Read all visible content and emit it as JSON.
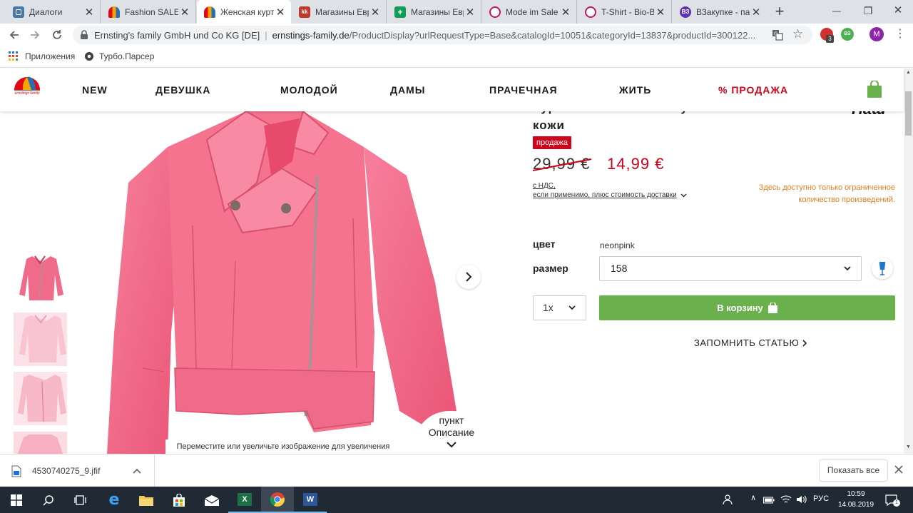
{
  "browser": {
    "tabs": [
      {
        "title": "Диалоги",
        "fav_color": "#4a76a8",
        "fav_text": "",
        "active": false
      },
      {
        "title": "Fashion SALE | Ernsting",
        "fav_color": "#e30613",
        "fav_text": "",
        "active": false
      },
      {
        "title": "Женская куртка",
        "fav_color": "#e30613",
        "fav_text": "",
        "active": true
      },
      {
        "title": "Магазины Европы",
        "fav_color": "#c0392b",
        "fav_text": "kk",
        "active": false
      },
      {
        "title": "Магазины Европы",
        "fav_color": "#0f9d58",
        "fav_text": "+",
        "active": false
      },
      {
        "title": "Mode im Sale",
        "fav_color": "#c2185b",
        "fav_text": "",
        "active": false
      },
      {
        "title": "T-Shirt - Bio-Baumwolle",
        "fav_color": "#c2185b",
        "fav_text": "",
        "active": false
      },
      {
        "title": "ВЗакупке - па",
        "fav_color": "#5e35b1",
        "fav_text": "ВЗ",
        "active": false
      }
    ],
    "new_tab": "+",
    "tab_close": "✕",
    "window_controls": {
      "minimize": "—",
      "maximize": "❐",
      "close": "✕"
    },
    "url_org": "Ernsting's family GmbH und Co KG [DE]",
    "url_domain": "ernstings-family.de",
    "url_path": "/ProductDisplay?urlRequestType=Base&catalogId=10051&categoryId=13837&productId=300122...",
    "extension_badges": {
      "abp_count": "3",
      "vz_label": "ВЗ",
      "profile_initial": "M"
    },
    "bookmarks": [
      {
        "label": "Приложения",
        "icon": "apps-grid-icon"
      },
      {
        "label": "Турбо.Парсер",
        "icon": "gear-icon"
      }
    ]
  },
  "site": {
    "logo_text": "ernstings family",
    "nav": [
      "NEW",
      "ДЕВУШКА",
      "МОЛОДОЙ",
      "ДАМЫ",
      "ПРАЧЕЧНАЯ",
      "ЖИТЬ",
      "% ПРОДАЖА"
    ],
    "sale_color": "#d0021b",
    "brand_partial": "Наш"
  },
  "product": {
    "title_line1": "Куртка женская из искусственной",
    "title_line2": "кожи",
    "sale_badge": "продажа",
    "old_price": "29,99 €",
    "new_price": "14,99 €",
    "vat_line1": "с НДС,",
    "vat_line2": "если применимо, плюс стоимость доставки",
    "limited_notice_line1": "Здесь доступно только ограниченное",
    "limited_notice_line2": "количество произведений.",
    "color_label": "цвет",
    "color_value": "neonpink",
    "size_label": "размер",
    "size_value": "158",
    "qty_value": "1x",
    "cart_button": "В корзину",
    "remember": "ЗАПОМНИТЬ СТАТЬЮ",
    "zoom_hint": "Переместите или увеличьте изображение для увеличения",
    "desc_line1": "пункт",
    "desc_line2": "Описание",
    "accent_green": "#6ab04c"
  },
  "download": {
    "file_name": "4530740275_9.jfif",
    "show_all": "Показать все"
  },
  "taskbar": {
    "language": "РУС",
    "time": "10:59",
    "date": "14.08.2019",
    "notifications": "1"
  }
}
